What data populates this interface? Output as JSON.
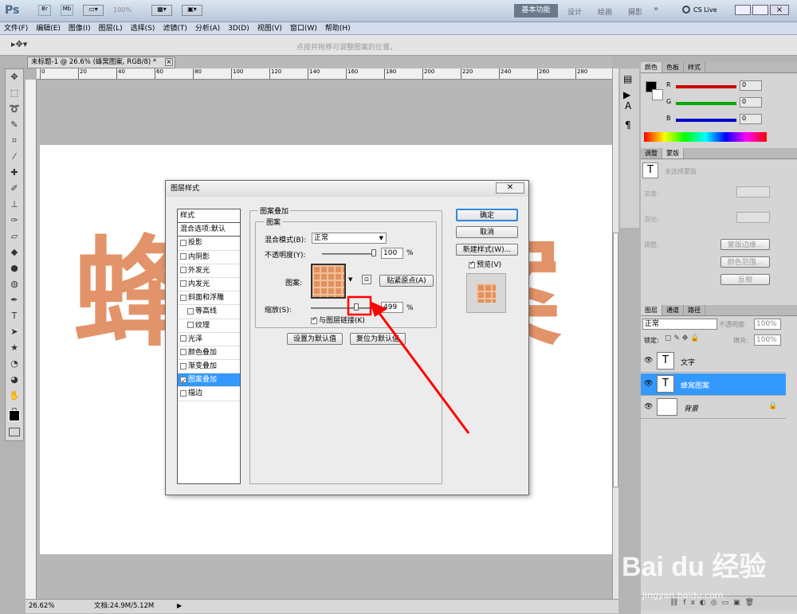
{
  "app": {
    "logo": "Ps",
    "zoom": "100%",
    "workspaces": [
      "基本功能",
      "设计",
      "绘画",
      "摄影"
    ],
    "cs_live": "CS Live"
  },
  "menu": [
    "文件(F)",
    "编辑(E)",
    "图像(I)",
    "图层(L)",
    "选择(S)",
    "滤镜(T)",
    "分析(A)",
    "3D(D)",
    "视图(V)",
    "窗口(W)",
    "帮助(H)"
  ],
  "options": {
    "hint": "点按并拖移可调整图案的位置。"
  },
  "document": {
    "tab": "未标题-1 @ 26.6% (蜂窝图案, RGB/8) *",
    "close": "×",
    "canvas_text": "蜂窝图案",
    "ruler_ticks": [
      "0",
      "20",
      "40",
      "60",
      "80",
      "100",
      "120",
      "140",
      "160",
      "180",
      "200",
      "220",
      "240",
      "260",
      "280"
    ]
  },
  "status": {
    "zoom": "26.62%",
    "doc": "文档:24.9M/5.12M"
  },
  "dialog": {
    "title": "图层样式",
    "styles_header": "样式",
    "blend_default": "混合选项:默认",
    "effects": [
      {
        "label": "投影",
        "checked": false,
        "indent": false
      },
      {
        "label": "内阴影",
        "checked": false,
        "indent": false
      },
      {
        "label": "外发光",
        "checked": false,
        "indent": false
      },
      {
        "label": "内发光",
        "checked": false,
        "indent": false
      },
      {
        "label": "斜面和浮雕",
        "checked": false,
        "indent": false
      },
      {
        "label": "等高线",
        "checked": false,
        "indent": true
      },
      {
        "label": "纹理",
        "checked": false,
        "indent": true
      },
      {
        "label": "光泽",
        "checked": false,
        "indent": false
      },
      {
        "label": "颜色叠加",
        "checked": false,
        "indent": false
      },
      {
        "label": "渐变叠加",
        "checked": false,
        "indent": false
      },
      {
        "label": "图案叠加",
        "checked": true,
        "indent": false,
        "selected": true
      },
      {
        "label": "描边",
        "checked": false,
        "indent": false
      }
    ],
    "section_title": "图案叠加",
    "group_title": "图案",
    "blend_mode_label": "混合模式(B):",
    "blend_mode_value": "正常",
    "opacity_label": "不透明度(Y):",
    "opacity_value": "100",
    "opacity_unit": "%",
    "pattern_label": "图案:",
    "snap_button": "贴紧原点(A)",
    "scale_label": "缩放(S):",
    "scale_value": "499",
    "scale_unit": "%",
    "link_label": "与图层链接(K)",
    "link_checked": true,
    "set_default": "设置为默认值",
    "reset_default": "复位为默认值",
    "ok": "确定",
    "cancel": "取消",
    "new_style": "新建样式(W)...",
    "preview_label": "预览(V)",
    "preview_checked": true
  },
  "color_panel": {
    "tabs": [
      "颜色",
      "色板",
      "样式"
    ],
    "channels": [
      {
        "label": "R",
        "value": "0",
        "color": "#cc0000"
      },
      {
        "label": "G",
        "value": "0",
        "color": "#00aa00"
      },
      {
        "label": "B",
        "value": "0",
        "color": "#0000cc"
      }
    ]
  },
  "adjust_panel": {
    "tabs": [
      "调整",
      "蒙版"
    ],
    "hint": "未选择蒙版",
    "density": "浓度:",
    "feather": "羽化:",
    "refine": "调整:",
    "buttons": [
      "蒙版边缘...",
      "颜色范围...",
      "反相"
    ]
  },
  "layers_panel": {
    "tabs": [
      "图层",
      "通道",
      "路径"
    ],
    "blend": "正常",
    "opacity_label": "不透明度:",
    "opacity": "100%",
    "lock_label": "锁定:",
    "fill_label": "填充:",
    "fill": "100%",
    "layers": [
      {
        "name": "文字",
        "type": "text",
        "selected": false
      },
      {
        "name": "蜂窝图案",
        "type": "text",
        "selected": true
      },
      {
        "name": "背景",
        "type": "bg",
        "selected": false
      }
    ]
  },
  "watermark": {
    "brand": "Bai du 经验",
    "url": "jingyan.baidu.com"
  },
  "colors": {
    "accent": "#3399ff",
    "pattern": "#e0915f",
    "annotation": "#ff0000"
  }
}
